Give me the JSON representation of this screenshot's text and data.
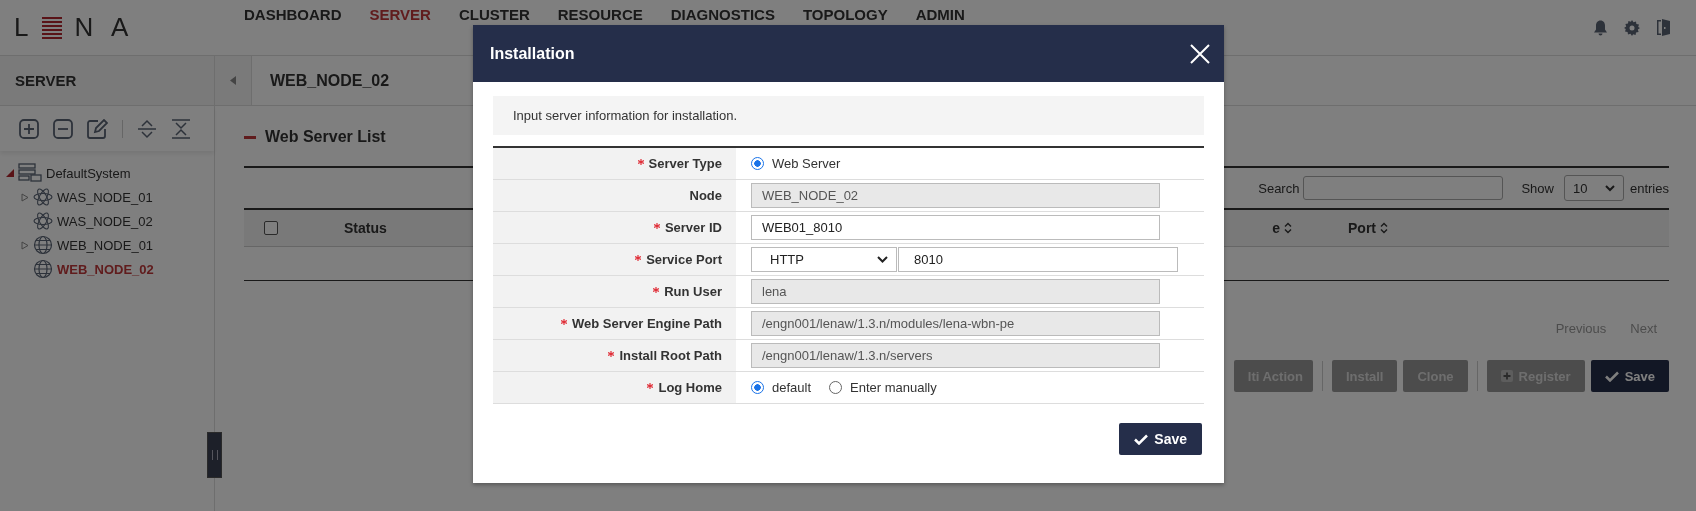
{
  "logo": {
    "left": "L",
    "right": "N A"
  },
  "nav": [
    {
      "label": "DASHBOARD",
      "selected": false
    },
    {
      "label": "SERVER",
      "selected": true
    },
    {
      "label": "CLUSTER",
      "selected": false
    },
    {
      "label": "RESOURCE",
      "selected": false
    },
    {
      "label": "DIAGNOSTICS",
      "selected": false
    },
    {
      "label": "TOPOLOGY",
      "selected": false
    },
    {
      "label": "ADMIN",
      "selected": false
    }
  ],
  "sidebar": {
    "title": "SERVER",
    "tree": [
      {
        "label": "DefaultSystem",
        "kind": "system",
        "expanded": true,
        "selected": false,
        "children": [
          {
            "label": "WAS_NODE_01",
            "kind": "was",
            "expanded": false,
            "selected": false
          },
          {
            "label": "WAS_NODE_02",
            "kind": "was",
            "selected": false
          },
          {
            "label": "WEB_NODE_01",
            "kind": "web",
            "expanded": false,
            "selected": false
          },
          {
            "label": "WEB_NODE_02",
            "kind": "web",
            "selected": true
          }
        ]
      }
    ]
  },
  "breadcrumb": "WEB_NODE_02",
  "section_title": "Web Server List",
  "search": {
    "label": "Search"
  },
  "show": {
    "label": "Show",
    "value": "10",
    "suffix": "entries"
  },
  "table": {
    "select_all_checked": false,
    "columns": [
      {
        "label": "Status",
        "sortable": false
      },
      {
        "label": "e",
        "sortable": true
      },
      {
        "label": "Port",
        "sortable": true
      }
    ]
  },
  "pagination": [
    "Previous",
    "Next"
  ],
  "actions": [
    {
      "label": "lti Action",
      "kind": "plain"
    },
    {
      "label": "Install",
      "kind": "plain"
    },
    {
      "label": "Clone",
      "kind": "plain"
    },
    {
      "label": "Register",
      "kind": "register"
    },
    {
      "label": "Save",
      "kind": "primary"
    }
  ],
  "modal": {
    "title": "Installation",
    "intro": "Input server information for installation.",
    "save_label": "Save",
    "fields": [
      {
        "label": "Server Type",
        "required": true,
        "kind": "radio",
        "options": [
          {
            "label": "Web Server",
            "selected": true
          }
        ]
      },
      {
        "label": "Node",
        "required": false,
        "kind": "text",
        "value": "WEB_NODE_02",
        "disabled": true
      },
      {
        "label": "Server ID",
        "required": true,
        "kind": "text",
        "value": "WEB01_8010",
        "disabled": false
      },
      {
        "label": "Service Port",
        "required": true,
        "kind": "select_text",
        "select": "HTTP",
        "value": "8010",
        "disabled": false
      },
      {
        "label": "Run User",
        "required": true,
        "kind": "text",
        "value": "lena",
        "disabled": true
      },
      {
        "label": "Web Server Engine Path",
        "required": true,
        "kind": "text",
        "value": "/engn001/lenaw/1.3.n/modules/lena-wbn-pe",
        "disabled": true
      },
      {
        "label": "Install Root Path",
        "required": true,
        "kind": "text",
        "value": "/engn001/lenaw/1.3.n/servers",
        "disabled": true
      },
      {
        "label": "Log Home",
        "required": true,
        "kind": "radio",
        "options": [
          {
            "label": "default",
            "selected": true
          },
          {
            "label": "Enter manually",
            "selected": false
          }
        ]
      }
    ]
  }
}
